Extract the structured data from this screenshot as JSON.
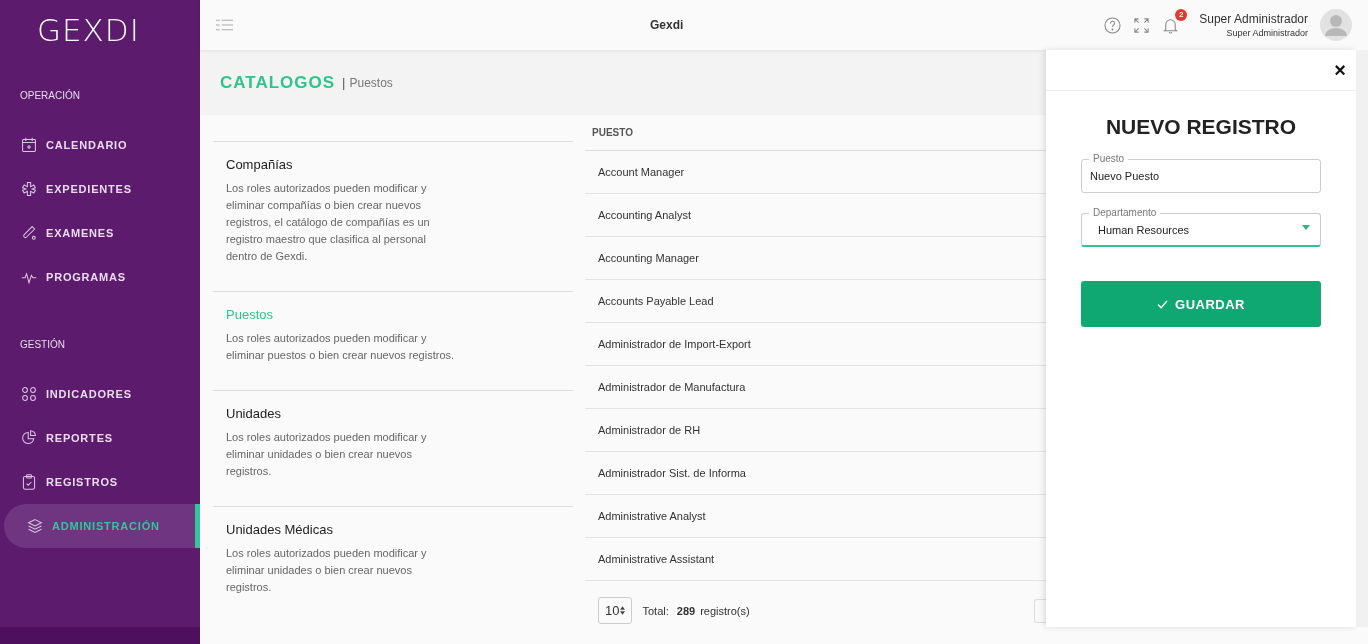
{
  "sidebar": {
    "logo": "GEXDI",
    "sections": [
      {
        "title": "OPERACIÓN",
        "items": [
          {
            "label": "CALENDARIO",
            "selected": false
          },
          {
            "label": "EXPEDIENTES",
            "selected": false
          },
          {
            "label": "EXAMENES",
            "selected": false
          },
          {
            "label": "PROGRAMAS",
            "selected": false
          }
        ]
      },
      {
        "title": "GESTIÓN",
        "items": [
          {
            "label": "INDICADORES",
            "selected": false
          },
          {
            "label": "REPORTES",
            "selected": false
          },
          {
            "label": "REGISTROS",
            "selected": false
          },
          {
            "label": "ADMINISTRACIÓN",
            "selected": true
          }
        ]
      }
    ]
  },
  "topbar": {
    "title": "Gexdi",
    "notifications": "2",
    "user_name": "Super Administrador",
    "user_role": "Super Administrador"
  },
  "page_header": {
    "title": "CATALOGOS",
    "separator": "|",
    "subtitle": "Puestos"
  },
  "catalogs": [
    {
      "title": "Compañías",
      "description": "Los roles autorizados pueden modificar y eliminar compañías o bien crear nuevos registros, el catálogo de compañías es un registro maestro que clasifica al personal dentro de Gexdi.",
      "selected": false
    },
    {
      "title": "Puestos",
      "description": "Los roles autorizados pueden modificar y eliminar puestos o bien crear nuevos registros.",
      "selected": true
    },
    {
      "title": "Unidades",
      "description": "Los roles autorizados pueden modificar y eliminar unidades o bien crear nuevos registros.",
      "selected": false
    },
    {
      "title": "Unidades Médicas",
      "description": "Los roles autorizados pueden modificar y eliminar unidades o bien crear nuevos registros.",
      "selected": false
    }
  ],
  "table": {
    "columns": [
      "PUESTO"
    ],
    "rows": [
      "Account Manager",
      "Accounting Analyst",
      "Accounting Manager",
      "Accounts Payable Lead",
      "Administrador de Import-Export",
      "Administrador de Manufactura",
      "Administrador de RH",
      "Administrador Sist. de Informa",
      "Administrative Analyst",
      "Administrative Assistant"
    ],
    "page_size": "10",
    "total_label": "Total:",
    "total": "289",
    "total_unit": "registro(s)"
  },
  "drawer": {
    "title": "NUEVO REGISTRO",
    "close": "×",
    "fields": [
      {
        "kind": "text",
        "label": "Puesto",
        "value": "Nuevo Puesto"
      },
      {
        "kind": "select",
        "label": "Departamento",
        "value": "Human Resources"
      }
    ],
    "save": "GUARDAR"
  }
}
